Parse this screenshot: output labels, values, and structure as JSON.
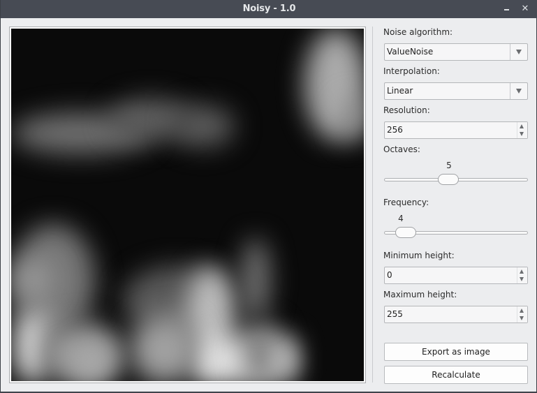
{
  "window": {
    "title": "Noisy - 1.0",
    "minimize_label": "–",
    "close_label": "✕"
  },
  "preview": {
    "description": "Generated grayscale noise heightmap preview"
  },
  "controls": {
    "noise_algorithm": {
      "label": "Noise algorithm:",
      "value": "ValueNoise"
    },
    "interpolation": {
      "label": "Interpolation:",
      "value": "Linear"
    },
    "resolution": {
      "label": "Resolution:",
      "value": "256"
    },
    "octaves": {
      "label": "Octaves:",
      "value": "5",
      "fraction": 0.44
    },
    "frequency": {
      "label": "Frequency:",
      "value": "4",
      "fraction": 0.09
    },
    "minimum_height": {
      "label": "Minimum height:",
      "value": "0"
    },
    "maximum_height": {
      "label": "Maximum height:",
      "value": "255"
    },
    "export_button": "Export as image",
    "recalculate_button": "Recalculate"
  }
}
